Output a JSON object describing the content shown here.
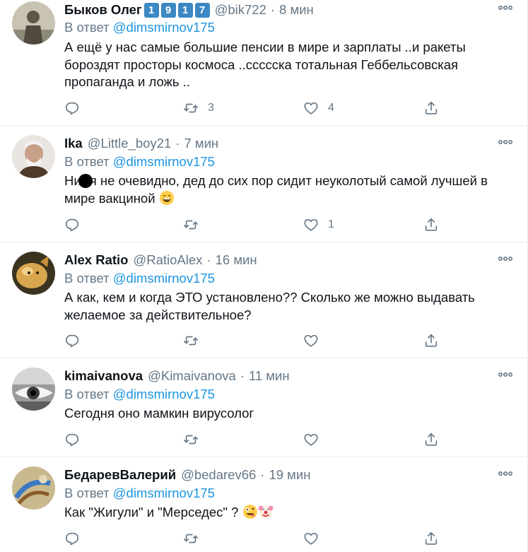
{
  "tweets": [
    {
      "name": "Быков Олег",
      "badges": [
        "1",
        "9",
        "1",
        "7"
      ],
      "handle": "@bik722",
      "time": "8 мин",
      "reply_prefix": "В ответ",
      "reply_to": "@dimsmirnov175",
      "text": "А ещё у нас самые большие пенсии в мире и зарплаты ..и ракеты бороздят просторы космоса ..ссссска тотальная Геббельсовская пропаганда и ложь ..",
      "retweets": "3",
      "likes": "4"
    },
    {
      "name": "Ika",
      "handle": "@Little_boy21",
      "time": "7 мин",
      "reply_prefix": "В ответ",
      "reply_to": "@dimsmirnov175",
      "text_a": "Ни",
      "text_b": "я не очевидно, дед до сих пор сидит неуколотый самой лучшей в мире вакциной",
      "emoji": "grinning-face",
      "retweets": "",
      "likes": "1"
    },
    {
      "name": "Alex Ratio",
      "handle": "@RatioAlex",
      "time": "16 мин",
      "reply_prefix": "В ответ",
      "reply_to": "@dimsmirnov175",
      "text": "А как, кем и когда ЭТО установлено?? Сколько же можно выдавать желаемое за действительное?",
      "retweets": "",
      "likes": ""
    },
    {
      "name": "kimaivanova",
      "handle": "@Kimaivanova",
      "time": "11 мин",
      "reply_prefix": "В ответ",
      "reply_to": "@dimsmirnov175",
      "text": "Сегодня оно мамкин вирусолог",
      "retweets": "",
      "likes": ""
    },
    {
      "name": "БедаревВалерий",
      "handle": "@bedarev66",
      "time": "19 мин",
      "reply_prefix": "В ответ",
      "reply_to": "@dimsmirnov175",
      "text": "Как \"Жигули\" и \"Мерседес\" ?",
      "emojis": [
        "zany-face",
        "clown-face"
      ],
      "retweets": "",
      "likes": ""
    }
  ],
  "colors": {
    "link": "#1b95e0",
    "secondary": "#657786",
    "divider": "#e6ecf0",
    "badge": "#3b88c3"
  },
  "icons": [
    "reply-icon",
    "retweet-icon",
    "like-icon",
    "share-icon",
    "more-icon"
  ]
}
